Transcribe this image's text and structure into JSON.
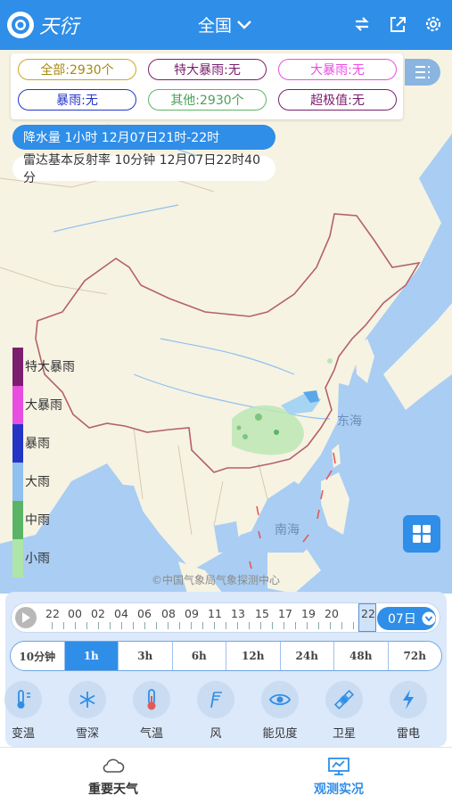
{
  "app": {
    "logo_text": "天衍",
    "region": "全国"
  },
  "filters": {
    "all": "全部:2930个",
    "extreme_rainstorm": "特大暴雨:无",
    "heavy_rainstorm": "大暴雨:无",
    "rainstorm": "暴雨:无",
    "other": "其他:2930个",
    "extreme_value": "超极值:无"
  },
  "layers": {
    "precipitation": "降水量 1小时 12月07日21时-22时",
    "radar": "雷达基本反射率 10分钟 12月07日22时40分"
  },
  "map": {
    "sea_labels": [
      "东海",
      "南海"
    ],
    "watermark": "©中国气象局气象探测中心"
  },
  "legend": [
    {
      "label": "特大暴雨",
      "color": "#7b1e6e"
    },
    {
      "label": "大暴雨",
      "color": "#e84ee0"
    },
    {
      "label": "暴雨",
      "color": "#2435c6"
    },
    {
      "label": "大雨",
      "color": "#8ec0f0"
    },
    {
      "label": "中雨",
      "color": "#5bb466"
    },
    {
      "label": "小雨",
      "color": "#aee5a8"
    }
  ],
  "timeline": {
    "hours": [
      "22",
      "00",
      "02",
      "04",
      "06",
      "08",
      "09",
      "11",
      "13",
      "15",
      "17",
      "19",
      "20",
      "22"
    ],
    "date": "07日"
  },
  "intervals": [
    "10分钟",
    "1h",
    "3h",
    "6h",
    "12h",
    "24h",
    "48h",
    "72h"
  ],
  "active_interval": "1h",
  "categories": [
    {
      "label": "变温",
      "icon": "thermometer-change-icon"
    },
    {
      "label": "雪深",
      "icon": "snowflake-icon"
    },
    {
      "label": "气温",
      "icon": "thermometer-icon"
    },
    {
      "label": "风",
      "icon": "wind-flag-icon"
    },
    {
      "label": "能见度",
      "icon": "eye-icon"
    },
    {
      "label": "卫星",
      "icon": "satellite-icon"
    },
    {
      "label": "雷电",
      "icon": "lightning-icon"
    }
  ],
  "nav": {
    "important_weather": "重要天气",
    "observation": "观测实况"
  },
  "colors": {
    "primary": "#2f8ee8",
    "map_sea": "#a9cdf3",
    "map_land": "#f7f4e6",
    "border": "#b5616a"
  }
}
